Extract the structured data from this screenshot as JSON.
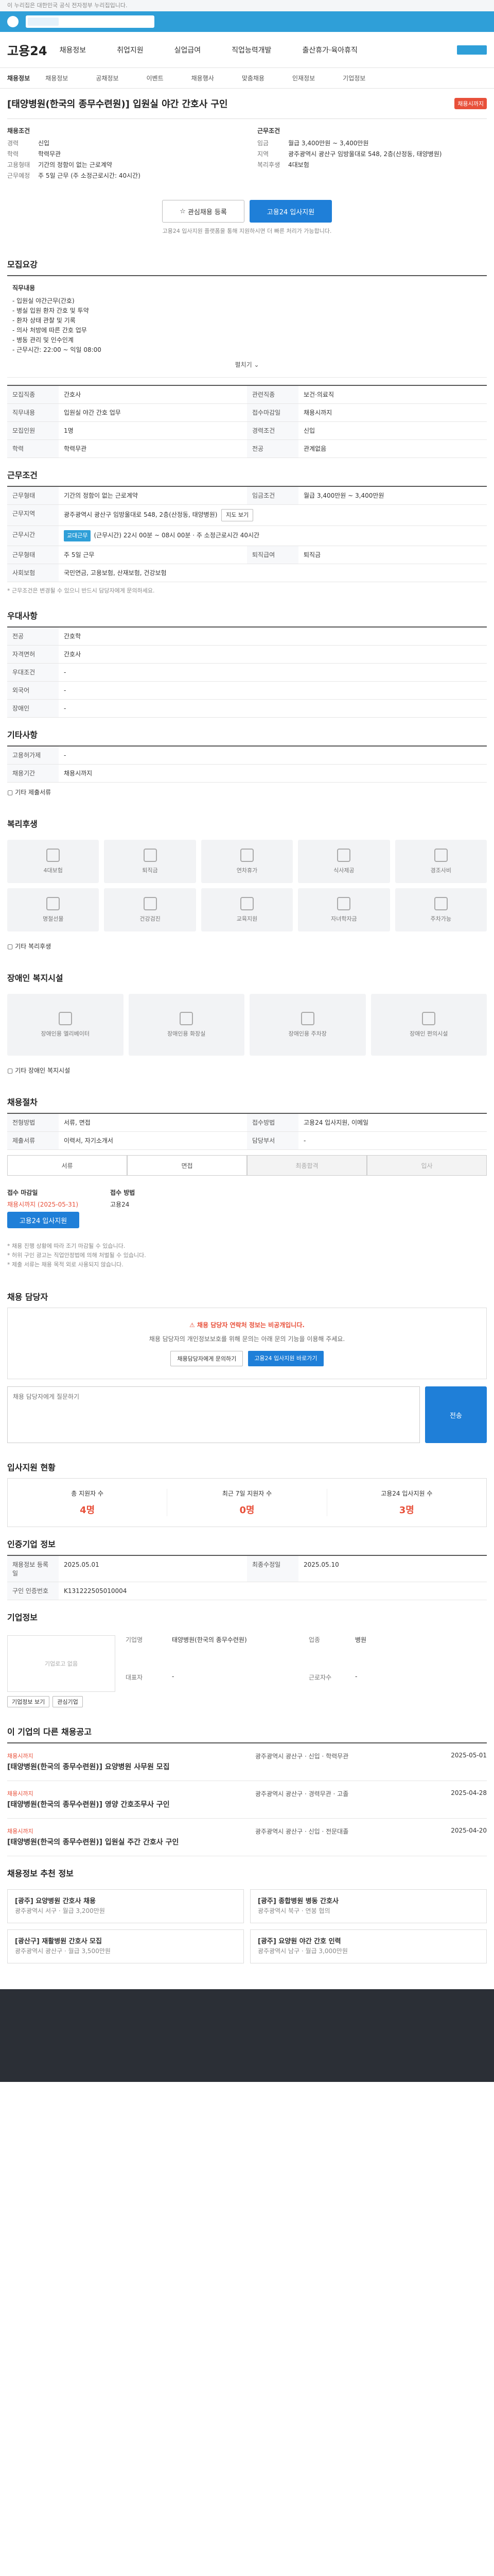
{
  "top_notice": "이 누리집은 대한민국 공식 전자정부 누리집입니다.",
  "gnb": {
    "logo": "고용24",
    "menu": [
      "채용정보",
      "취업지원",
      "실업급여",
      "직업능력개발",
      "출산휴가·육아휴직"
    ]
  },
  "subnav": {
    "label": "채용정보",
    "tabs": [
      "채용정보",
      "공채정보",
      "이벤트",
      "채용행사",
      "맞춤채용",
      "인재정보",
      "기업정보"
    ]
  },
  "job": {
    "title": "[태양병원(한국의 종무수련원)] 입원실 야간 간호사 구인",
    "badge": "채용시까지",
    "left_head": "채용조건",
    "right_head": "근무조건",
    "left": [
      {
        "k": "경력",
        "v": "신입"
      },
      {
        "k": "학력",
        "v": "학력무관"
      },
      {
        "k": "고용형태",
        "v": "기간의 정함이 없는 근로계약"
      },
      {
        "k": "근무예정",
        "v": "주 5일 근무 (주 소정근로시간: 40시간)"
      }
    ],
    "right": [
      {
        "k": "임금",
        "v": "월급 3,400만원 ~ 3,400만원"
      },
      {
        "k": "지역",
        "v": "광주광역시 광산구 임방울대로 548, 2층(산정동, 태양병원)"
      },
      {
        "k": "복리후생",
        "v": "4대보험"
      }
    ],
    "btn_interest": "관심채용 등록",
    "btn_apply": "고용24 입사지원",
    "note": "고용24 입사지원 플랫폼을 통해 지원하시면 더 빠른 처리가 가능합니다."
  },
  "recruit": {
    "section": "모집요강",
    "detail_title": "직무내용",
    "detail_lines": [
      "- 입원실 야간근무(간호)",
      "- 병실 입원 환자 간호 및 투약",
      "- 환자 상태 관찰 및 기록",
      "- 의사 처방에 따른 간호 업무",
      "- 병동 관리 및 인수인계",
      "- 근무시간: 22:00 ~ 익일 08:00"
    ],
    "more": "펼치기",
    "rows": [
      {
        "k": "모집직종",
        "v": "간호사"
      },
      {
        "k": "관련직종",
        "v": "보건·의료직"
      },
      {
        "k": "직무내용",
        "v": "입원실 야간 간호 업무"
      },
      {
        "k": "접수마감일",
        "v": "채용시까지"
      },
      {
        "k": "모집인원",
        "v": "1명"
      },
      {
        "k": "경력조건",
        "v": "신입"
      },
      {
        "k": "학력",
        "v": "학력무관"
      },
      {
        "k": "전공",
        "v": "관계없음"
      }
    ]
  },
  "condition": {
    "section": "근무조건",
    "rows": [
      {
        "k": "근무형태",
        "v": "기간의 정함이 없는 근로계약"
      },
      {
        "k": "임금조건",
        "v": "월급 3,400만원 ~ 3,400만원"
      },
      {
        "k": "근무지역",
        "v": "광주광역시 광산구 임방울대로 548, 2층(산정동, 태양병원)"
      },
      {
        "k": "근무시간",
        "v": "(근무시간) 22시 00분 ~ 08시 00분 · 주 소정근로시간 40시간"
      },
      {
        "k": "근무형태",
        "v": "주 5일 근무"
      },
      {
        "k": "사회보험",
        "v": "국민연금, 고용보험, 산재보험, 건강보험"
      },
      {
        "k": "퇴직급여",
        "v": "퇴직금"
      }
    ],
    "chip": "교대근무",
    "map_btn": "지도 보기",
    "warn": "* 근무조건은 변경될 수 있으니 반드시 담당자에게 문의하세요."
  },
  "prefer": {
    "section": "우대사항",
    "rows": [
      {
        "k": "전공",
        "v": "간호학"
      },
      {
        "k": "자격면허",
        "v": "간호사"
      },
      {
        "k": "우대조건",
        "v": "-"
      },
      {
        "k": "외국어",
        "v": "-"
      },
      {
        "k": "장애인",
        "v": "-"
      }
    ]
  },
  "etc_cond": {
    "section": "기타사항",
    "rows": [
      {
        "k": "고용허가제",
        "v": "-"
      },
      {
        "k": "채용기간",
        "v": "채용시까지"
      }
    ],
    "etc_text": "기타 제출서류"
  },
  "welfare": {
    "section": "복리후생",
    "cards": [
      "4대보험",
      "퇴직금",
      "연차휴가",
      "식사제공",
      "경조사비",
      "명절선물",
      "건강검진",
      "교육지원",
      "자녀학자금",
      "주차가능"
    ],
    "etc_label": "기타 복리후생"
  },
  "disabled": {
    "section": "장애인 복지시설",
    "cards": [
      "장애인용 엘리베이터",
      "장애인용 화장실",
      "장애인용 주차장",
      "장애인 편의시설"
    ],
    "etc_label": "기타 장애인 복지시설"
  },
  "process": {
    "section": "채용절차",
    "rows": [
      {
        "k": "전형방법",
        "v": "서류, 면접"
      },
      {
        "k": "접수방법",
        "v": "고용24 입사지원, 이메일"
      },
      {
        "k": "제출서류",
        "v": "이력서, 자기소개서"
      },
      {
        "k": "담당부서",
        "v": "-"
      }
    ],
    "steps": [
      "서류",
      "면접",
      "최종합격",
      "입사"
    ],
    "apply_label": "접수 마감일",
    "apply_value": "채용시까지 (2025-05-31)",
    "apply_btn": "고용24 입사지원",
    "method_label": "접수 방법",
    "method_value": "고용24",
    "notes": [
      "* 채용 진행 상황에 따라 조기 마감될 수 있습니다.",
      "* 허위 구인 광고는 직업안정법에 의해 처벌될 수 있습니다.",
      "* 제출 서류는 채용 목적 외로 사용되지 않습니다."
    ]
  },
  "manager": {
    "section": "채용 담당자",
    "warn": "채용 담당자 연락처 정보는 비공개입니다.",
    "desc": "채용 담당자의 개인정보보호를 위해 문의는 아래 문의 기능을 이용해 주세요.",
    "b1": "채용담당자에게 문의하기",
    "b2": "고용24 입사지원 바로가기",
    "placeholder": "채용 담당자에게 질문하기",
    "send": "전송"
  },
  "stats": {
    "section": "입사지원 현황",
    "items": [
      {
        "label": "총 지원자 수",
        "value": "4명"
      },
      {
        "label": "최근 7일 지원자 수",
        "value": "0명"
      },
      {
        "label": "고용24 입사지원 수",
        "value": "3명"
      }
    ]
  },
  "info": {
    "section": "인증기업 정보",
    "rows": [
      {
        "k": "채용정보 등록일",
        "v": "2025.05.01"
      },
      {
        "k": "최종수정일",
        "v": "2025.05.10"
      },
      {
        "k": "구인 인증번호",
        "v": "K131222505010004"
      }
    ]
  },
  "company": {
    "section": "기업정보",
    "logo_text": "기업로고 없음",
    "info": [
      {
        "k": "기업명",
        "v": "태양병원(한국의 종무수련원)"
      },
      {
        "k": "업종",
        "v": "병원"
      },
      {
        "k": "대표자",
        "v": "-"
      },
      {
        "k": "근로자수",
        "v": "-"
      }
    ],
    "btn1": "기업정보 보기",
    "btn2": "관심기업"
  },
  "others": {
    "section": "이 기업의 다른 채용공고",
    "items": [
      {
        "cat": "채용시까지",
        "title": "[태양병원(한국의 종무수련원)] 요양병원 사무원 모집",
        "mid": "광주광역시 광산구 · 신입 · 학력무관",
        "date": "2025-05-01"
      },
      {
        "cat": "채용시까지",
        "title": "[태양병원(한국의 종무수련원)] 영양 간호조무사 구인",
        "mid": "광주광역시 광산구 · 경력무관 · 고졸",
        "date": "2025-04-28"
      },
      {
        "cat": "채용시까지",
        "title": "[태양병원(한국의 종무수련원)] 입원실 주간 간호사 구인",
        "mid": "광주광역시 광산구 · 신입 · 전문대졸",
        "date": "2025-04-20"
      }
    ]
  },
  "recommend": {
    "section": "채용정보 추천 정보",
    "cards": [
      {
        "title": "[광주] 요양병원 간호사 채용",
        "sub": "광주광역시 서구 · 월급 3,200만원"
      },
      {
        "title": "[광주] 종합병원 병동 간호사",
        "sub": "광주광역시 북구 · 연봉 협의"
      },
      {
        "title": "[광산구] 재활병원 간호사 모집",
        "sub": "광주광역시 광산구 · 월급 3,500만원"
      },
      {
        "title": "[광주] 요양원 야간 간호 인력",
        "sub": "광주광역시 남구 · 월급 3,000만원"
      }
    ]
  }
}
